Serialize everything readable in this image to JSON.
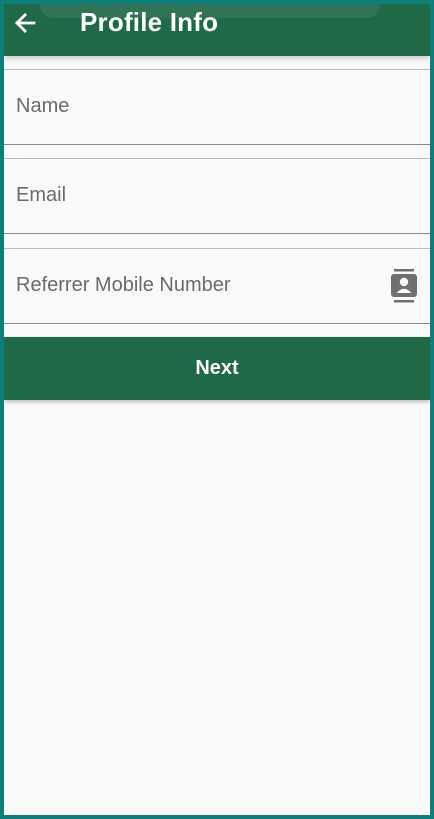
{
  "app_bar": {
    "title": "Profile Info",
    "back_icon": "arrow-left-icon"
  },
  "form": {
    "name_placeholder": "Name",
    "email_placeholder": "Email",
    "referrer_placeholder": "Referrer Mobile Number",
    "referrer_icon": "contact-book-icon"
  },
  "actions": {
    "next_label": "Next"
  },
  "colors": {
    "primary": "#1f6848",
    "frame": "#0e7f78",
    "background": "#fafafa",
    "hint_text": "#6b6b6b"
  }
}
